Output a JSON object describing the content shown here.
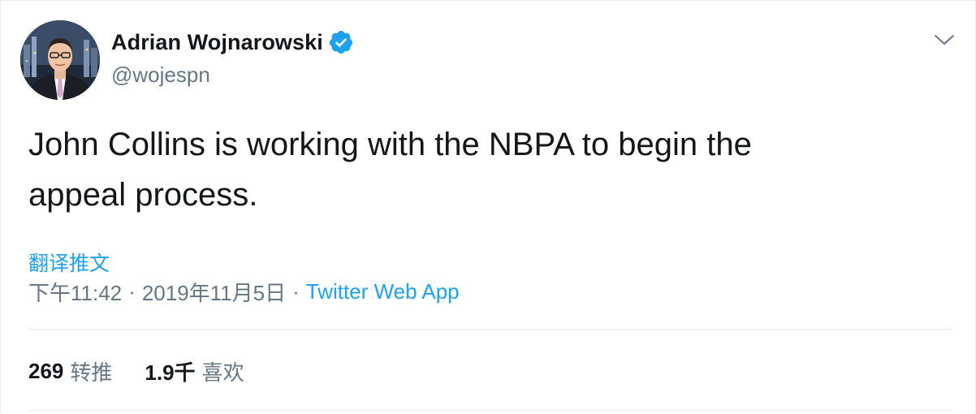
{
  "tweet": {
    "author": {
      "display_name": "Adrian Wojnarowski",
      "handle": "@wojespn",
      "verified": true,
      "avatar_icon": "profile-photo"
    },
    "text": "John Collins is working with the NBPA to begin the\nappeal process.",
    "translate_label": "翻译推文",
    "time": "下午11:42",
    "date": "2019年11月5日",
    "separator": "·",
    "source": "Twitter Web App",
    "stats": {
      "retweets_count": "269",
      "retweets_label": "转推",
      "likes_count": "1.9千",
      "likes_label": "喜欢"
    }
  },
  "icons": {
    "verified": "verified-badge-icon",
    "menu": "chevron-down-icon"
  },
  "colors": {
    "link": "#1da1f2",
    "secondary_text": "#657786",
    "primary_text": "#14171a",
    "divider": "#e6ecf0"
  }
}
